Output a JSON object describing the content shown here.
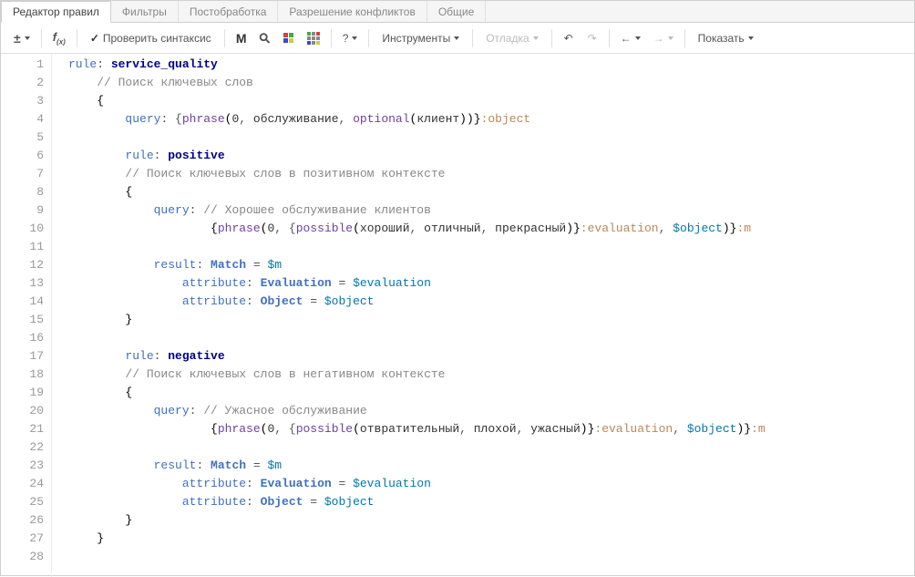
{
  "tabs": [
    {
      "label": "Редактор правил",
      "active": true
    },
    {
      "label": "Фильтры",
      "active": false
    },
    {
      "label": "Постобработка",
      "active": false
    },
    {
      "label": "Разрешение конфликтов",
      "active": false
    },
    {
      "label": "Общие",
      "active": false
    }
  ],
  "toolbar": {
    "check_syntax": "Проверить синтаксис",
    "tools": "Инструменты",
    "debug": "Отладка",
    "show": "Показать",
    "question": "?"
  },
  "lines": [
    {
      "n": 1,
      "tokens": [
        {
          "t": "rule",
          "c": "kw"
        },
        {
          "t": ": ",
          "c": "sym"
        },
        {
          "t": "service_quality",
          "c": "ident"
        }
      ]
    },
    {
      "n": 2,
      "indent": 1,
      "tokens": [
        {
          "t": "// Поиск ключевых слов",
          "c": "comment"
        }
      ]
    },
    {
      "n": 3,
      "indent": 1,
      "tokens": [
        {
          "t": "{",
          "c": "paren"
        }
      ]
    },
    {
      "n": 4,
      "indent": 2,
      "tokens": [
        {
          "t": "query",
          "c": "kw"
        },
        {
          "t": ": {",
          "c": "sym"
        },
        {
          "t": "phrase",
          "c": "func"
        },
        {
          "t": "(",
          "c": "paren"
        },
        {
          "t": "0",
          "c": "str-lit"
        },
        {
          "t": ", ",
          "c": "sym"
        },
        {
          "t": "обслуживание",
          "c": "str-lit"
        },
        {
          "t": ", ",
          "c": "sym"
        },
        {
          "t": "optional",
          "c": "func"
        },
        {
          "t": "(",
          "c": "paren"
        },
        {
          "t": "клиент",
          "c": "str-lit"
        },
        {
          "t": "))}",
          "c": "paren"
        },
        {
          "t": ":object",
          "c": "colon-mod"
        }
      ]
    },
    {
      "n": 5,
      "tokens": []
    },
    {
      "n": 6,
      "indent": 2,
      "tokens": [
        {
          "t": "rule",
          "c": "kw"
        },
        {
          "t": ": ",
          "c": "sym"
        },
        {
          "t": "positive",
          "c": "ident"
        }
      ]
    },
    {
      "n": 7,
      "indent": 2,
      "tokens": [
        {
          "t": "// Поиск ключевых слов в позитивном контексте",
          "c": "comment"
        }
      ]
    },
    {
      "n": 8,
      "indent": 2,
      "tokens": [
        {
          "t": "{",
          "c": "paren"
        }
      ]
    },
    {
      "n": 9,
      "indent": 3,
      "tokens": [
        {
          "t": "query",
          "c": "kw"
        },
        {
          "t": ": ",
          "c": "sym"
        },
        {
          "t": "// Хорошее обслуживание клиентов",
          "c": "comment"
        }
      ]
    },
    {
      "n": 10,
      "indent": 5,
      "tokens": [
        {
          "t": "{",
          "c": "paren"
        },
        {
          "t": "phrase",
          "c": "func"
        },
        {
          "t": "(",
          "c": "paren"
        },
        {
          "t": "0",
          "c": "str-lit"
        },
        {
          "t": ", {",
          "c": "sym"
        },
        {
          "t": "possible",
          "c": "func"
        },
        {
          "t": "(",
          "c": "paren"
        },
        {
          "t": "хороший",
          "c": "str-lit"
        },
        {
          "t": ", ",
          "c": "sym"
        },
        {
          "t": "отличный",
          "c": "str-lit"
        },
        {
          "t": ", ",
          "c": "sym"
        },
        {
          "t": "прекрасный",
          "c": "str-lit"
        },
        {
          "t": ")}",
          "c": "paren"
        },
        {
          "t": ":evaluation",
          "c": "colon-mod"
        },
        {
          "t": ", ",
          "c": "sym"
        },
        {
          "t": "$object",
          "c": "var"
        },
        {
          "t": ")}",
          "c": "paren"
        },
        {
          "t": ":m",
          "c": "colon-mod"
        }
      ]
    },
    {
      "n": 11,
      "tokens": []
    },
    {
      "n": 12,
      "indent": 3,
      "tokens": [
        {
          "t": "result",
          "c": "kw"
        },
        {
          "t": ": ",
          "c": "sym"
        },
        {
          "t": "Match",
          "c": "kw-bold"
        },
        {
          "t": " = ",
          "c": "sym"
        },
        {
          "t": "$m",
          "c": "var"
        }
      ]
    },
    {
      "n": 13,
      "indent": 4,
      "tokens": [
        {
          "t": "attribute",
          "c": "kw"
        },
        {
          "t": ": ",
          "c": "sym"
        },
        {
          "t": "Evaluation",
          "c": "kw-bold"
        },
        {
          "t": " = ",
          "c": "sym"
        },
        {
          "t": "$evaluation",
          "c": "var"
        }
      ]
    },
    {
      "n": 14,
      "indent": 4,
      "tokens": [
        {
          "t": "attribute",
          "c": "kw"
        },
        {
          "t": ": ",
          "c": "sym"
        },
        {
          "t": "Object",
          "c": "kw-bold"
        },
        {
          "t": " = ",
          "c": "sym"
        },
        {
          "t": "$object",
          "c": "var"
        }
      ]
    },
    {
      "n": 15,
      "indent": 2,
      "tokens": [
        {
          "t": "}",
          "c": "paren"
        }
      ]
    },
    {
      "n": 16,
      "tokens": []
    },
    {
      "n": 17,
      "indent": 2,
      "tokens": [
        {
          "t": "rule",
          "c": "kw"
        },
        {
          "t": ": ",
          "c": "sym"
        },
        {
          "t": "negative",
          "c": "ident"
        }
      ]
    },
    {
      "n": 18,
      "indent": 2,
      "tokens": [
        {
          "t": "// Поиск ключевых слов в негативном контексте",
          "c": "comment"
        }
      ]
    },
    {
      "n": 19,
      "indent": 2,
      "tokens": [
        {
          "t": "{",
          "c": "paren"
        }
      ]
    },
    {
      "n": 20,
      "indent": 3,
      "tokens": [
        {
          "t": "query",
          "c": "kw"
        },
        {
          "t": ": ",
          "c": "sym"
        },
        {
          "t": "// Ужасное обслуживание",
          "c": "comment"
        }
      ]
    },
    {
      "n": 21,
      "indent": 5,
      "tokens": [
        {
          "t": "{",
          "c": "paren"
        },
        {
          "t": "phrase",
          "c": "func"
        },
        {
          "t": "(",
          "c": "paren"
        },
        {
          "t": "0",
          "c": "str-lit"
        },
        {
          "t": ", {",
          "c": "sym"
        },
        {
          "t": "possible",
          "c": "func"
        },
        {
          "t": "(",
          "c": "paren"
        },
        {
          "t": "отвратительный",
          "c": "str-lit"
        },
        {
          "t": ", ",
          "c": "sym"
        },
        {
          "t": "плохой",
          "c": "str-lit"
        },
        {
          "t": ", ",
          "c": "sym"
        },
        {
          "t": "ужасный",
          "c": "str-lit"
        },
        {
          "t": ")}",
          "c": "paren"
        },
        {
          "t": ":evaluation",
          "c": "colon-mod"
        },
        {
          "t": ", ",
          "c": "sym"
        },
        {
          "t": "$object",
          "c": "var"
        },
        {
          "t": ")}",
          "c": "paren"
        },
        {
          "t": ":m",
          "c": "colon-mod"
        }
      ]
    },
    {
      "n": 22,
      "tokens": []
    },
    {
      "n": 23,
      "indent": 3,
      "tokens": [
        {
          "t": "result",
          "c": "kw"
        },
        {
          "t": ": ",
          "c": "sym"
        },
        {
          "t": "Match",
          "c": "kw-bold"
        },
        {
          "t": " = ",
          "c": "sym"
        },
        {
          "t": "$m",
          "c": "var"
        }
      ]
    },
    {
      "n": 24,
      "indent": 4,
      "tokens": [
        {
          "t": "attribute",
          "c": "kw"
        },
        {
          "t": ": ",
          "c": "sym"
        },
        {
          "t": "Evaluation",
          "c": "kw-bold"
        },
        {
          "t": " = ",
          "c": "sym"
        },
        {
          "t": "$evaluation",
          "c": "var"
        }
      ]
    },
    {
      "n": 25,
      "indent": 4,
      "tokens": [
        {
          "t": "attribute",
          "c": "kw"
        },
        {
          "t": ": ",
          "c": "sym"
        },
        {
          "t": "Object",
          "c": "kw-bold"
        },
        {
          "t": " = ",
          "c": "sym"
        },
        {
          "t": "$object",
          "c": "var"
        }
      ]
    },
    {
      "n": 26,
      "indent": 2,
      "tokens": [
        {
          "t": "}",
          "c": "paren"
        }
      ]
    },
    {
      "n": 27,
      "indent": 1,
      "tokens": [
        {
          "t": "}",
          "c": "paren"
        }
      ]
    },
    {
      "n": 28,
      "tokens": []
    }
  ]
}
